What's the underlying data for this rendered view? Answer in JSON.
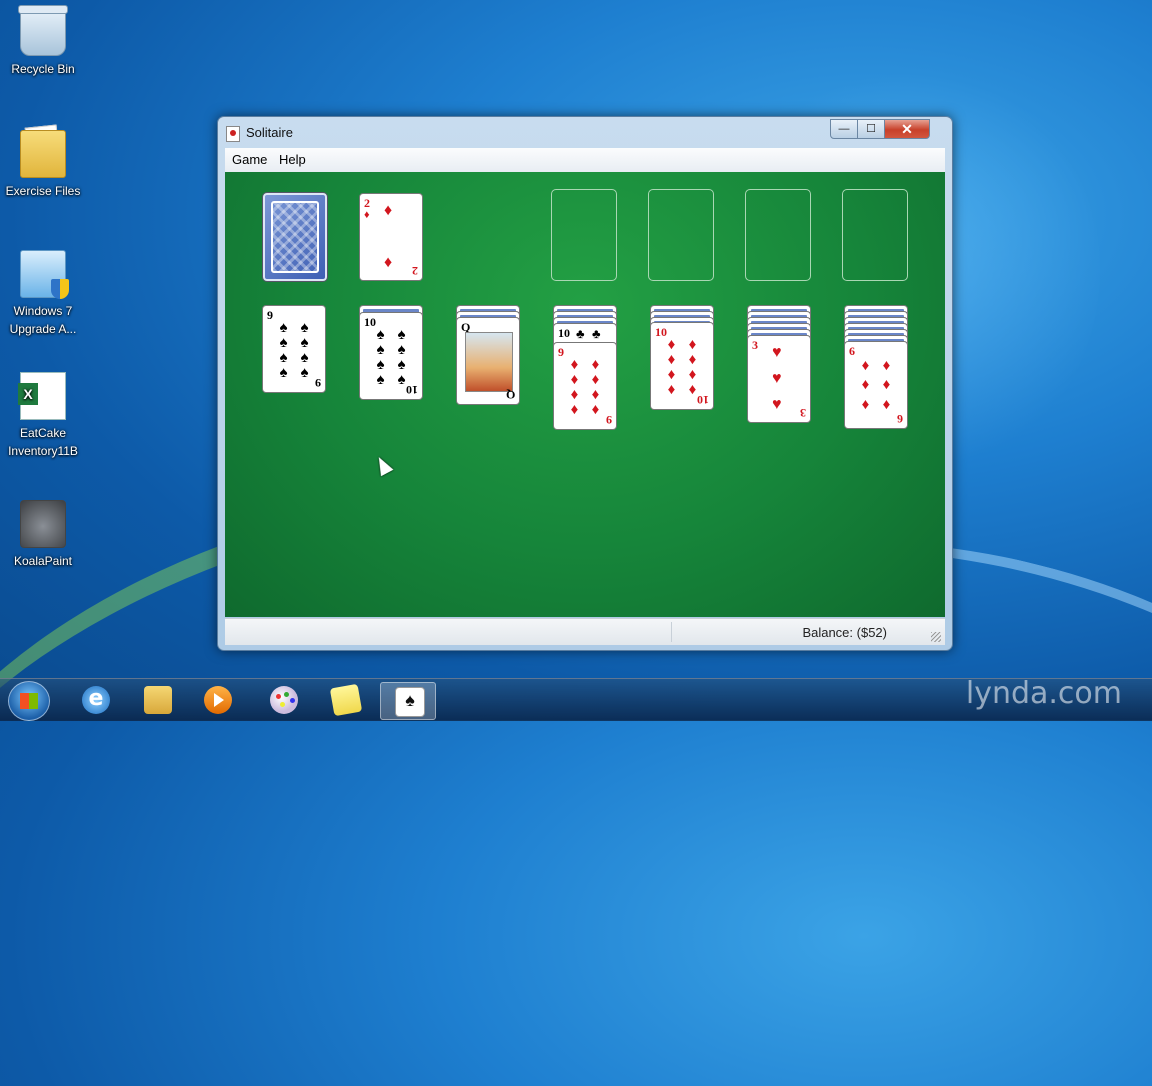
{
  "desktop": {
    "icons": [
      {
        "label": "Recycle Bin",
        "icon": "recycle-bin-icon"
      },
      {
        "label": "Exercise Files",
        "icon": "folder-icon"
      },
      {
        "label": "Windows 7 Upgrade A...",
        "icon": "windows-upgrade-icon"
      },
      {
        "label": "EatCake Inventory11B",
        "icon": "excel-file-icon"
      },
      {
        "label": "KoalaPaint",
        "icon": "koala-paint-icon"
      }
    ]
  },
  "window": {
    "title": "Solitaire",
    "buttons": {
      "minimize": "—",
      "maximize": "☐",
      "close": "✕"
    },
    "menu": [
      "Game",
      "Help"
    ],
    "status": {
      "balance": "Balance: ($52)"
    }
  },
  "game": {
    "stock": {
      "face": "down"
    },
    "waste": {
      "rank": "2",
      "suit": "♦",
      "color": "red"
    },
    "foundations": [
      "empty",
      "empty",
      "empty",
      "empty"
    ],
    "tableau": [
      {
        "hidden": 0,
        "top": {
          "rank": "9",
          "suit": "♠",
          "color": "black"
        }
      },
      {
        "hidden": 1,
        "top": {
          "rank": "10",
          "suit": "♠",
          "color": "black"
        }
      },
      {
        "hidden": 2,
        "top": {
          "rank": "Q",
          "suit": "♣",
          "color": "black"
        }
      },
      {
        "hidden": 3,
        "visible_above": {
          "rank": "10",
          "suit": "♣"
        },
        "top": {
          "rank": "9",
          "suit": "♦",
          "color": "red"
        }
      },
      {
        "hidden": 4,
        "top": {
          "rank": "10",
          "suit": "♦",
          "color": "red"
        }
      },
      {
        "hidden": 5,
        "top": {
          "rank": "3",
          "suit": "♥",
          "color": "red"
        }
      },
      {
        "hidden": 6,
        "top": {
          "rank": "6",
          "suit": "♦",
          "color": "red"
        }
      }
    ]
  },
  "taskbar": {
    "items": [
      "start-button",
      "internet-explorer",
      "windows-explorer",
      "media-player",
      "paint",
      "sticky-notes",
      "solitaire"
    ],
    "active": "solitaire"
  },
  "watermark": "lynda.com"
}
